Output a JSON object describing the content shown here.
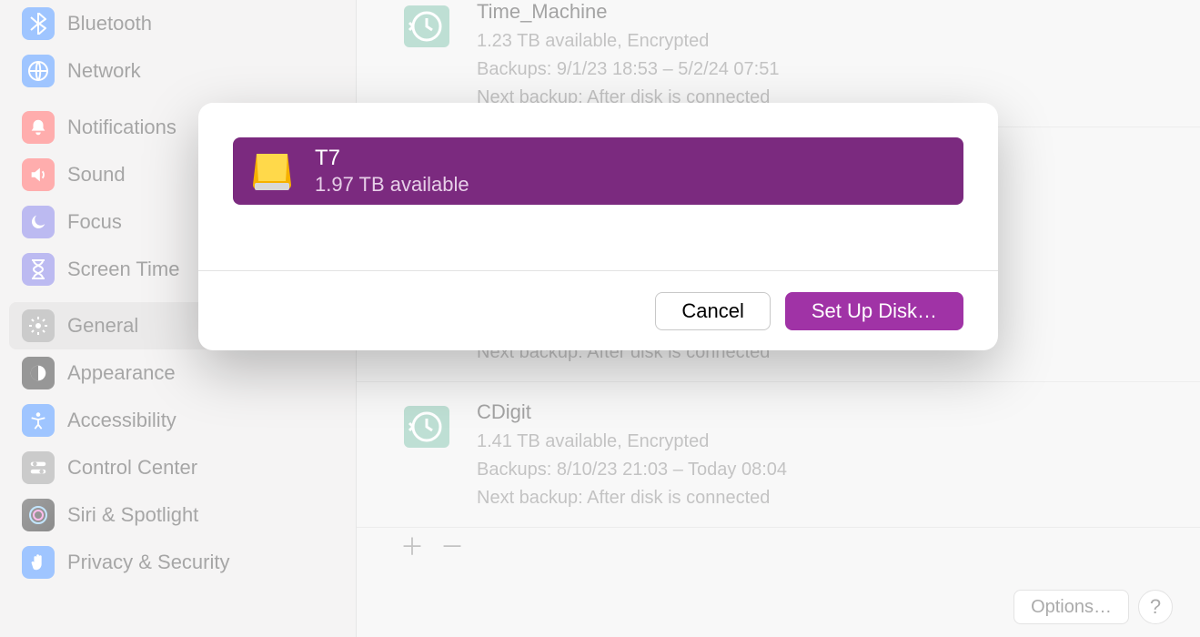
{
  "sidebar": {
    "items": [
      {
        "label": "Bluetooth"
      },
      {
        "label": "Network"
      },
      {
        "label": "Notifications"
      },
      {
        "label": "Sound"
      },
      {
        "label": "Focus"
      },
      {
        "label": "Screen Time"
      },
      {
        "label": "General"
      },
      {
        "label": "Appearance"
      },
      {
        "label": "Accessibility"
      },
      {
        "label": "Control Center"
      },
      {
        "label": "Siri & Spotlight"
      },
      {
        "label": "Privacy & Security"
      }
    ]
  },
  "backups": [
    {
      "name": "Time_Machine",
      "status": "1.23 TB available, Encrypted",
      "range": "Backups: 9/1/23 18:53 – 5/2/24 07:51",
      "next": "Next backup: After disk is connected"
    },
    {
      "name": "",
      "status": "",
      "range": "",
      "next": "Next backup: After disk is connected"
    },
    {
      "name": "CDigit",
      "status": "1.41 TB available, Encrypted",
      "range": "Backups: 8/10/23 21:03 – Today 08:04",
      "next": "Next backup: After disk is connected"
    }
  ],
  "footer": {
    "options": "Options…",
    "help": "?"
  },
  "modal": {
    "disk": {
      "name": "T7",
      "status": "1.97 TB available"
    },
    "cancel": "Cancel",
    "confirm": "Set Up Disk…"
  }
}
